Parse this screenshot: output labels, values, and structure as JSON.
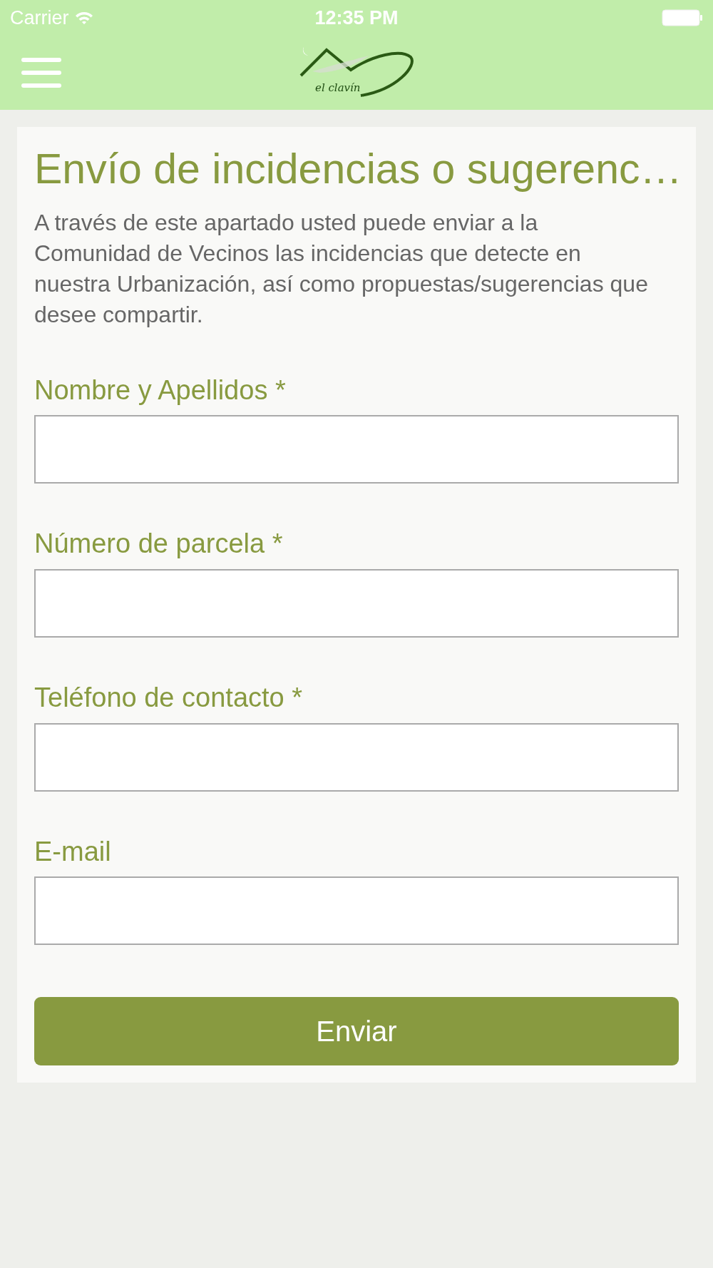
{
  "status_bar": {
    "carrier": "Carrier",
    "time": "12:35 PM"
  },
  "header": {
    "logo_text": "el clavín"
  },
  "form": {
    "title": "Envío de incidencias o sugerenc…",
    "intro": "A través de este apartado usted puede enviar a la Comunidad de Vecinos las incidencias que detecte en nuestra Urbanización, así como  propuestas/sugerencias que desee compartir.",
    "fields": [
      {
        "label": "Nombre y Apellidos *"
      },
      {
        "label": "Número de parcela *"
      },
      {
        "label": "Teléfono de contacto *"
      },
      {
        "label": "E-mail"
      }
    ],
    "submit": "Enviar"
  }
}
